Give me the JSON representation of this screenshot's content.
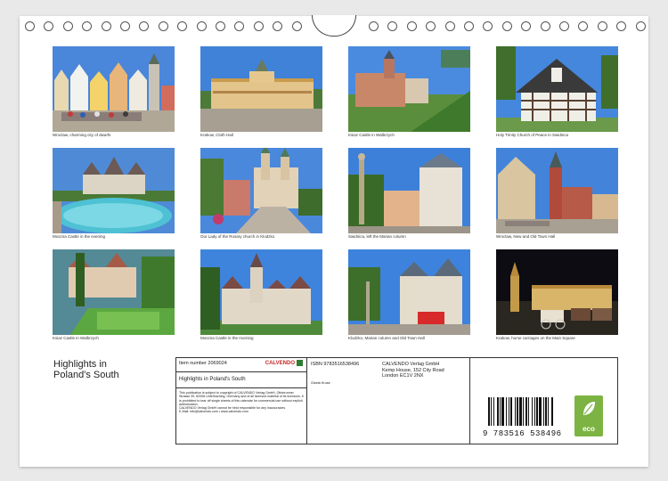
{
  "photos": [
    {
      "caption": "Wroclaw, charming city of dwarfs"
    },
    {
      "caption": "Krakow, Cloth Hall"
    },
    {
      "caption": "Ksiaz Castle in Walbrzych"
    },
    {
      "caption": "Holy Trinity Church of Peace in Swidnica"
    },
    {
      "caption": "Moszna Castle in the evening"
    },
    {
      "caption": "Our Lady of the Rosary church in Klodzko"
    },
    {
      "caption": "Swidnica, left the Marian column"
    },
    {
      "caption": "Wroclaw, New and Old Town Hall"
    },
    {
      "caption": "Ksiaz Castle in Walbrzych"
    },
    {
      "caption": "Moszna Castle in the morning"
    },
    {
      "caption": "Klodzko, Marian column and Old Town Hall"
    },
    {
      "caption": "Krakow, horse carriages on the Main Square"
    }
  ],
  "title_block": {
    "line1": "Highlights in",
    "line2": "Poland's South"
  },
  "info": {
    "item_number": "Item number 2069024",
    "logo_text": "CALVENDO",
    "product_title": "Highlights in Poland's South",
    "copyright": "This publication is subject to copyright of CALVENDO Verlag GmbH, Ottobrunner Strasse 39, 82008 Unterhaching, Germany and of all licensed material of its licensors. It is prohibited to tear off single sheets of this calendar for commercial use without explicit authorization.",
    "liability": "CALVENDO Verlag GmbH cannot be held responsible for any inaccuracies.",
    "contact": "E-Mail: info@calvendo.com • www.calvendo.com",
    "isbn": "ISBN 9783516538496",
    "author": "Gisela Kruse",
    "publisher_line1": "CALVENDO Verlag GmbH",
    "publisher_line2": "Kemp House, 152 City Road",
    "publisher_line3": "London EC1V 2NX",
    "ean": "9 783516 538496",
    "eco_label": "eco"
  },
  "colors": {
    "sky": "#3d7fd6",
    "eco_green": "#7cb342",
    "calvendo_red": "#c62828"
  }
}
